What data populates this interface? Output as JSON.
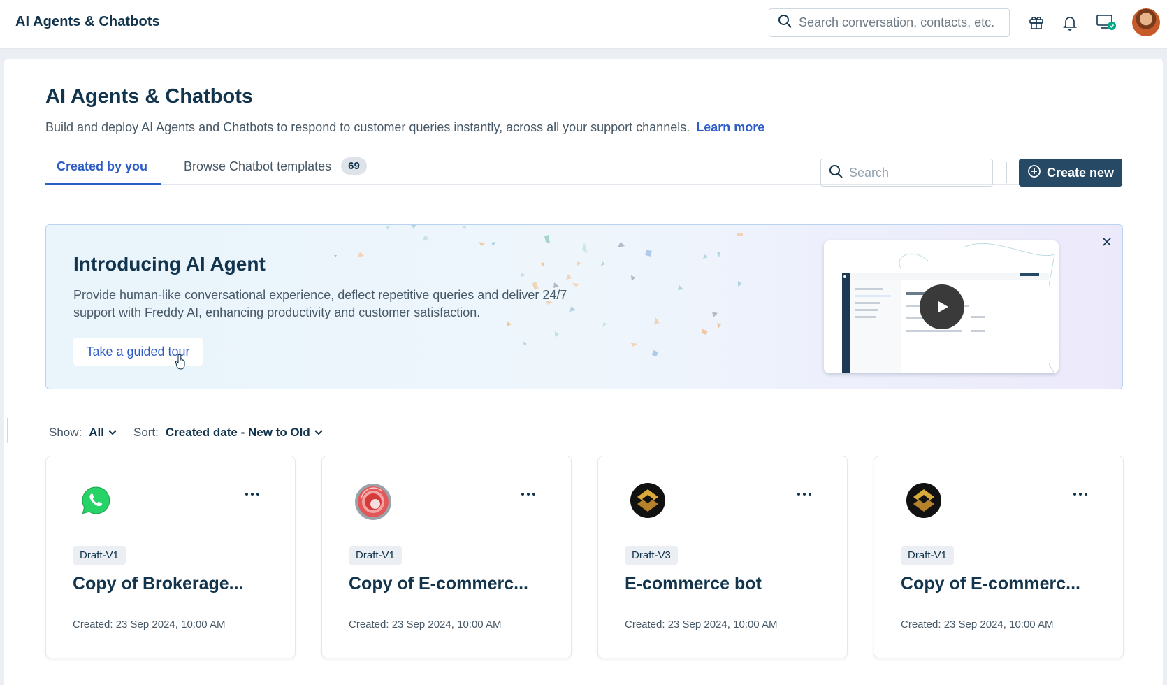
{
  "app": {
    "title": "AI Agents & Chatbots"
  },
  "header": {
    "search_placeholder": "Search conversation, contacts, etc.",
    "icons": [
      "gift-icon",
      "bell-icon",
      "monitor-status-icon",
      "avatar"
    ]
  },
  "page": {
    "title": "AI Agents & Chatbots",
    "description": "Build and deploy AI Agents and Chatbots to respond to customer queries instantly, across all your support channels.",
    "learn_more": "Learn more"
  },
  "tabs": [
    {
      "label": "Created by you",
      "active": true
    },
    {
      "label": "Browse Chatbot templates",
      "badge": "69",
      "active": false
    }
  ],
  "toolbar": {
    "search_placeholder": "Search",
    "create_label": "Create new"
  },
  "banner": {
    "title": "Introducing AI Agent",
    "text": "Provide human-like conversational experience, deflect repetitive queries and deliver 24/7 support with Freddy AI, enhancing productivity and customer satisfaction.",
    "tour_label": "Take a guided tour"
  },
  "filters": {
    "show_label": "Show:",
    "show_value": "All",
    "sort_label": "Sort:",
    "sort_value": "Created date - New to Old"
  },
  "cards": [
    {
      "logo": "whatsapp-logo-icon",
      "badge": "Draft-V1",
      "title": "Copy of Brokerage...",
      "created": "Created: 23 Sep 2024, 10:00 AM"
    },
    {
      "logo": "red-ring-logo-icon",
      "badge": "Draft-V1",
      "title": "Copy of E-commerc...",
      "created": "Created: 23 Sep 2024, 10:00 AM"
    },
    {
      "logo": "gold-diamond-logo-icon",
      "badge": "Draft-V3",
      "title": "E-commerce bot",
      "created": "Created: 23 Sep 2024, 10:00 AM"
    },
    {
      "logo": "gold-diamond-logo-icon",
      "badge": "Draft-V1",
      "title": "Copy of E-commerc...",
      "created": "Created: 23 Sep 2024, 10:00 AM"
    }
  ],
  "colors": {
    "brand_blue": "#2c5cc5",
    "primary_button": "#264966",
    "text_dark": "#12344d",
    "status_green": "#00a886"
  }
}
